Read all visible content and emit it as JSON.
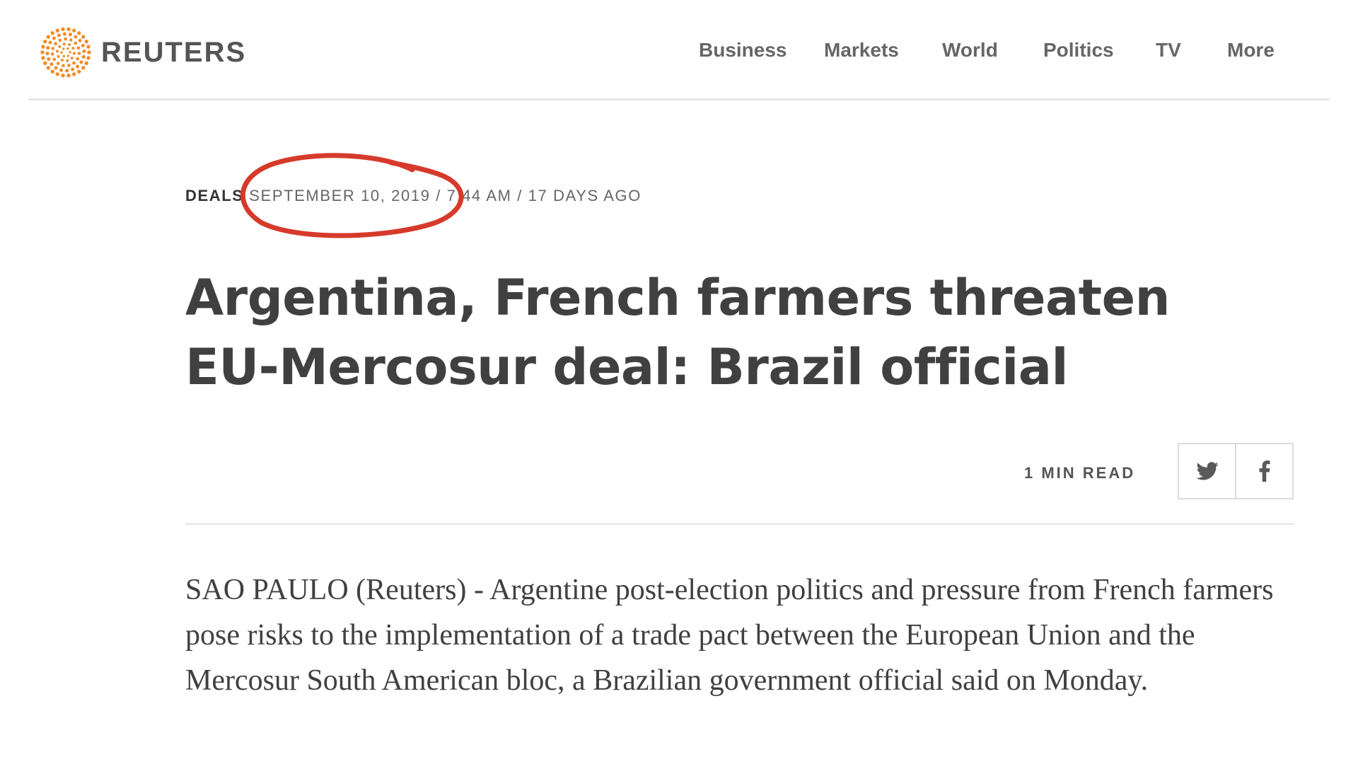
{
  "brand": {
    "name": "REUTERS",
    "logo_icon": "reuters-dot-ring-icon",
    "logo_color": "#f28c28"
  },
  "nav": {
    "items": [
      {
        "label": "Business"
      },
      {
        "label": "Markets"
      },
      {
        "label": "World"
      },
      {
        "label": "Politics"
      },
      {
        "label": "TV"
      },
      {
        "label": "More"
      }
    ]
  },
  "article": {
    "channel": "DEALS",
    "date_line": "SEPTEMBER 10, 2019 / 7:44 AM / 17 DAYS AGO",
    "headline": "Argentina, French farmers threaten EU-Mercosur deal: Brazil official",
    "read_time": "1 MIN READ",
    "body": "SAO PAULO (Reuters) - Argentine post-election politics and pressure from French farmers pose risks to the implementation of a trade pact between the European Union and the Mercosur South American bloc, a Brazilian government official said on Monday."
  },
  "share": {
    "twitter_icon": "twitter-icon",
    "facebook_icon": "facebook-icon"
  },
  "annotation": {
    "color": "#d63a2b",
    "shape": "hand-drawn ellipse around date"
  }
}
